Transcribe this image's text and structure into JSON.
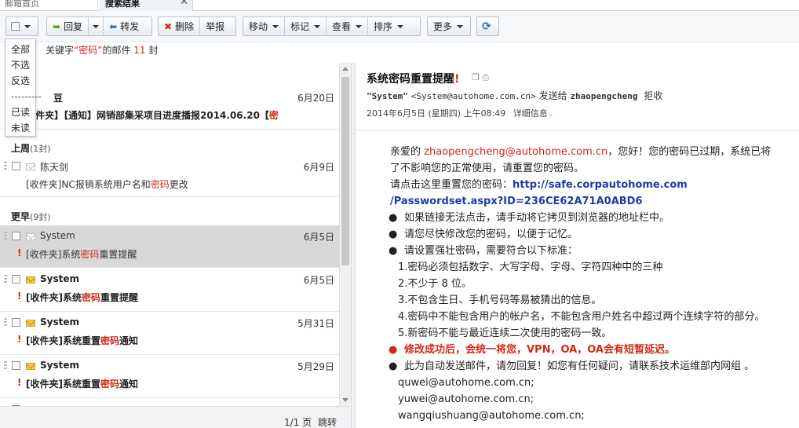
{
  "tabs": {
    "inbox": "邮箱首页",
    "search": "搜索结果",
    "close": "✕"
  },
  "toolbar": {
    "reply": "回复",
    "forward": "转发",
    "delete": "删除",
    "report": "举报",
    "move": "移动",
    "mark": "标记",
    "view": "查看",
    "sort": "排序",
    "more": "更多"
  },
  "select_menu": [
    "全部",
    "不选",
    "反选",
    "---------",
    "已读",
    "未读"
  ],
  "search_info": {
    "prefix": "关键字",
    "keyword": "“密码”",
    "suffix": "的邮件",
    "count": "11",
    "unit": "封"
  },
  "list": {
    "top_mail": {
      "sender": "豆",
      "date": "6月20日",
      "subject_prefix": "件夹】【通知】网销部集采项目进度播报2014.06.20【",
      "subject_hl": "密"
    },
    "sections": [
      {
        "title": "上周",
        "count": "(1封)"
      },
      {
        "title": "更早",
        "count": "(9封)"
      }
    ],
    "mails": [
      {
        "sender": "陈天剑",
        "date": "6月9日",
        "pre": "[收件夹]NC报销系统用户名和",
        "hl": "密码",
        "post": "更改"
      },
      {
        "sender": "System",
        "date": "6月5日",
        "pre": "[收件夹]系统",
        "hl": "密码",
        "post": "重置提醒"
      },
      {
        "sender": "System",
        "date": "6月5日",
        "pre": "[收件夹]系统",
        "hl": "密码",
        "post": "重置提醒"
      },
      {
        "sender": "System",
        "date": "5月31日",
        "pre": "[收件夹]系统重置",
        "hl": "密码",
        "post": "通知"
      },
      {
        "sender": "System",
        "date": "5月29日",
        "pre": "[收件夹]系统重置",
        "hl": "密码",
        "post": "通知"
      }
    ]
  },
  "pager": {
    "page": "1/1 页",
    "jump": "跳转"
  },
  "reader": {
    "title": "系统密码重置提醒",
    "from_name": "\"System\"",
    "from_addr": "<System@autohome.com.cn>",
    "sent_to": "发送给",
    "to": "zhaopengcheng",
    "reject": "拒收",
    "date": "2014年6月5日 (星期四) 上午08:49",
    "details": "详细信息",
    "greeting": "亲爱的",
    "email": "zhaopengcheng@autohome.com.cn",
    "line1_post": "，您好！您的密码已过期，系统已将",
    "line2": "了不影响您的正常使用，请重置您的密码。",
    "link_label": "请点击这里重置您的密码：",
    "link1": "http://safe.corpautohome.com",
    "link2": "/Passwordset.aspx?ID=236CE62A71A0ABD6",
    "bullets1": [
      "如果链接无法点击，请手动将它拷贝到浏览器的地址栏中。",
      "请您尽快修改您的密码，以便于记忆。",
      "请设置强壮密码，需要符合以下标准："
    ],
    "rules": [
      "1.密码必须包括数字、大写字母、字母、字符四种中的三种",
      "2.不少于 8 位。",
      "3.不包含生日、手机号码等易被猜出的信息。",
      "4.密码中不能包含用户的帐户名，不能包含用户姓名中超过两个连续字符的部分。",
      "5.新密码不能与最近连续二次使用的密码一致。"
    ],
    "warning": "修改成功后，会统一将您，VPN，OA，OA会有短暂延迟。",
    "auto_note": "此为自动发送邮件，请勿回复！如您有任何疑问，请联系技术运维部内网组 。",
    "contacts": [
      "quwei@autohome.com.cn;",
      "yuwei@autohome.com.cn;",
      "wangqiushuang@autohome.com.cn;"
    ]
  }
}
